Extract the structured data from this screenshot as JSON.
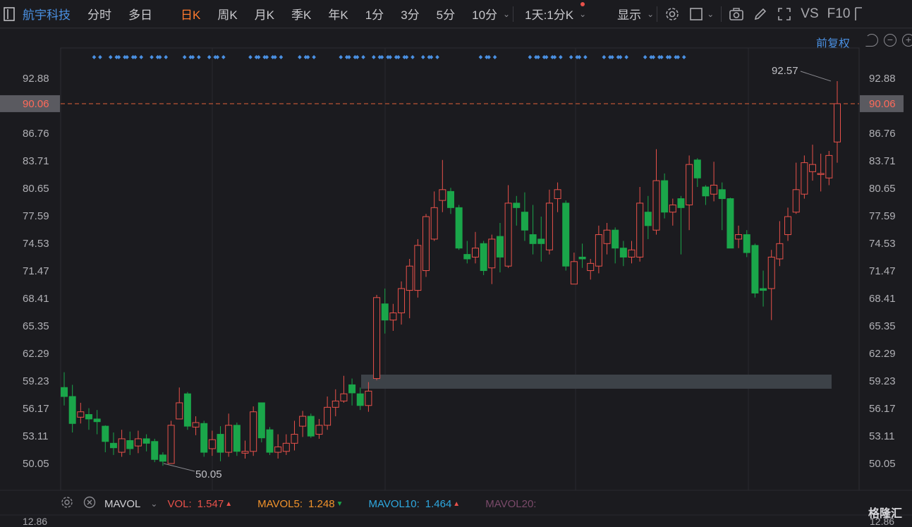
{
  "toolbar": {
    "stock_name": "航宇科技",
    "periods": [
      "分时",
      "多日",
      "日K",
      "周K",
      "月K",
      "季K",
      "年K",
      "1分",
      "3分",
      "5分",
      "10分"
    ],
    "active_period": "日K",
    "timeframe": "1天:1分K",
    "display": "显示",
    "vs": "VS",
    "f10": "F10"
  },
  "price_adjust": "前复权",
  "price_axis": [
    "92.88",
    "90.06",
    "86.76",
    "83.71",
    "80.65",
    "77.59",
    "74.53",
    "71.47",
    "68.41",
    "65.35",
    "62.29",
    "59.23",
    "56.17",
    "53.11",
    "50.05"
  ],
  "current_price": "90.06",
  "high_label": "92.57",
  "low_label": "50.05",
  "volume_panel": {
    "indicator": "MAVOL",
    "vol_label": "VOL:",
    "vol_value": "1.547",
    "mavol5_label": "MAVOL5:",
    "mavol5_value": "1.248",
    "mavol10_label": "MAVOL10:",
    "mavol10_value": "1.464",
    "mavol20_label": "MAVOL20:",
    "axis_top": "12.86"
  },
  "brand": "格隆汇",
  "colors": {
    "up": "#e8514a",
    "down": "#1aa64a",
    "accent": "#ff7a2e",
    "link": "#4a90e2",
    "bg": "#1b1b1f"
  },
  "chart_data": {
    "type": "candlestick",
    "y_range": [
      48.5,
      94.5
    ],
    "candles": [
      [
        58.5,
        57.5,
        60.2,
        56.5
      ],
      [
        57.5,
        54.5,
        58.8,
        53.5
      ],
      [
        55.2,
        55.8,
        56.8,
        54.5
      ],
      [
        55.5,
        55.0,
        56.2,
        53.8
      ],
      [
        55.0,
        54.7,
        56.0,
        53.3
      ],
      [
        54.2,
        52.5,
        54.3,
        51.3
      ],
      [
        52.3,
        51.8,
        53.5,
        51.0
      ],
      [
        51.3,
        52.8,
        53.8,
        50.8
      ],
      [
        52.6,
        51.7,
        53.6,
        51.0
      ],
      [
        52.0,
        52.8,
        53.7,
        51.2
      ],
      [
        52.8,
        52.3,
        53.3,
        51.4
      ],
      [
        52.5,
        50.5,
        52.8,
        50.2
      ],
      [
        51.0,
        50.3,
        51.3,
        49.8
      ],
      [
        50.05,
        54.3,
        54.8,
        50.05
      ],
      [
        55.0,
        56.8,
        58.5,
        55.2
      ],
      [
        57.8,
        54.2,
        58.0,
        53.8
      ],
      [
        54.1,
        54.6,
        55.3,
        53.2
      ],
      [
        54.5,
        51.3,
        54.8,
        50.8
      ],
      [
        51.7,
        52.7,
        53.7,
        50.9
      ],
      [
        53.3,
        51.3,
        54.2,
        50.3
      ],
      [
        51.3,
        54.3,
        55.6,
        50.8
      ],
      [
        54.3,
        51.4,
        54.6,
        50.9
      ],
      [
        51.2,
        51.4,
        52.6,
        50.6
      ],
      [
        51.4,
        55.8,
        56.4,
        50.9
      ],
      [
        56.8,
        52.9,
        56.8,
        52.4
      ],
      [
        53.8,
        51.3,
        54.1,
        51.0
      ],
      [
        51.3,
        51.9,
        53.3,
        50.6
      ],
      [
        51.4,
        52.3,
        53.3,
        51.0
      ],
      [
        52.3,
        53.3,
        54.8,
        51.5
      ],
      [
        54.2,
        55.3,
        55.9,
        53.0
      ],
      [
        55.3,
        53.1,
        55.6,
        52.9
      ],
      [
        53.3,
        54.3,
        55.0,
        52.8
      ],
      [
        54.3,
        56.3,
        57.5,
        53.8
      ],
      [
        56.3,
        57.0,
        58.3,
        55.3
      ],
      [
        57.0,
        57.8,
        59.8,
        56.8
      ],
      [
        58.8,
        57.9,
        59.5,
        56.5
      ],
      [
        57.8,
        56.5,
        58.5,
        56.0
      ],
      [
        56.5,
        58.1,
        59.1,
        55.8
      ],
      [
        59.5,
        68.5,
        68.8,
        59.3
      ],
      [
        67.8,
        66.0,
        69.5,
        64.5
      ],
      [
        66.0,
        66.8,
        67.8,
        64.8
      ],
      [
        66.8,
        69.5,
        70.3,
        65.5
      ],
      [
        69.3,
        72.0,
        72.8,
        66.2
      ],
      [
        69.3,
        74.3,
        75.0,
        68.5
      ],
      [
        71.5,
        77.5,
        77.8,
        70.8
      ],
      [
        75.0,
        78.5,
        80.3,
        74.8
      ],
      [
        79.3,
        80.5,
        83.8,
        78.0
      ],
      [
        80.3,
        78.5,
        80.7,
        77.8
      ],
      [
        78.5,
        74.0,
        78.8,
        73.8
      ],
      [
        73.3,
        72.8,
        74.8,
        72.3
      ],
      [
        73.0,
        74.0,
        75.8,
        72.3
      ],
      [
        74.5,
        71.5,
        74.8,
        71.0
      ],
      [
        71.8,
        75.0,
        75.5,
        70.0
      ],
      [
        75.3,
        73.0,
        76.8,
        71.3
      ],
      [
        72.0,
        79.0,
        81.0,
        71.8
      ],
      [
        79.0,
        78.5,
        79.8,
        76.5
      ],
      [
        78.0,
        76.0,
        80.2,
        74.8
      ],
      [
        75.5,
        74.5,
        78.8,
        73.3
      ],
      [
        75.0,
        74.5,
        77.5,
        72.5
      ],
      [
        73.8,
        79.0,
        80.5,
        73.3
      ],
      [
        79.5,
        80.5,
        81.3,
        78.0
      ],
      [
        79.0,
        72.0,
        79.3,
        71.5
      ],
      [
        70.0,
        72.5,
        73.5,
        70.0
      ],
      [
        73.0,
        72.8,
        74.5,
        71.8
      ],
      [
        71.5,
        72.3,
        72.8,
        70.5
      ],
      [
        72.0,
        75.5,
        76.5,
        71.2
      ],
      [
        74.5,
        76.0,
        76.8,
        73.3
      ],
      [
        76.0,
        74.0,
        76.3,
        72.3
      ],
      [
        74.0,
        73.0,
        74.8,
        72.0
      ],
      [
        73.0,
        73.8,
        74.8,
        72.3
      ],
      [
        73.0,
        79.0,
        80.8,
        72.5
      ],
      [
        78.0,
        76.5,
        79.8,
        75.0
      ],
      [
        76.0,
        81.5,
        85.0,
        75.5
      ],
      [
        81.5,
        78.0,
        82.3,
        77.3
      ],
      [
        78.0,
        78.8,
        79.5,
        76.5
      ],
      [
        79.5,
        78.5,
        79.8,
        73.3
      ],
      [
        78.8,
        83.3,
        84.3,
        76.0
      ],
      [
        83.8,
        81.8,
        84.0,
        80.8
      ],
      [
        80.8,
        79.8,
        81.0,
        78.8
      ],
      [
        80.0,
        81.0,
        83.6,
        79.2
      ],
      [
        80.5,
        79.5,
        81.3,
        76.0
      ],
      [
        79.5,
        74.0,
        79.6,
        74.0
      ],
      [
        75.0,
        75.5,
        76.5,
        74.0
      ],
      [
        75.5,
        73.5,
        76.0,
        73.0
      ],
      [
        74.3,
        69.0,
        74.5,
        68.5
      ],
      [
        69.5,
        69.3,
        71.5,
        67.5
      ],
      [
        69.5,
        73.0,
        73.8,
        66.0
      ],
      [
        72.8,
        74.5,
        77.0,
        72.0
      ],
      [
        75.5,
        77.5,
        78.5,
        74.8
      ],
      [
        78.0,
        80.5,
        83.5,
        77.8
      ],
      [
        80.0,
        83.5,
        84.3,
        79.5
      ],
      [
        82.5,
        83.3,
        85.5,
        81.5
      ],
      [
        82.3,
        82.3,
        84.5,
        80.3
      ],
      [
        81.8,
        84.3,
        84.8,
        81.0
      ],
      [
        85.8,
        90.06,
        92.57,
        83.5
      ]
    ],
    "signals": [
      4,
      6,
      7,
      8,
      9,
      11,
      12,
      15,
      16,
      18,
      19,
      23,
      24,
      25,
      26,
      29,
      30,
      34,
      35,
      36,
      38,
      39,
      40,
      41,
      42,
      44,
      45,
      51,
      52,
      57,
      58,
      59,
      60,
      62,
      63,
      66,
      67,
      68,
      71,
      72,
      73,
      74,
      75
    ]
  }
}
